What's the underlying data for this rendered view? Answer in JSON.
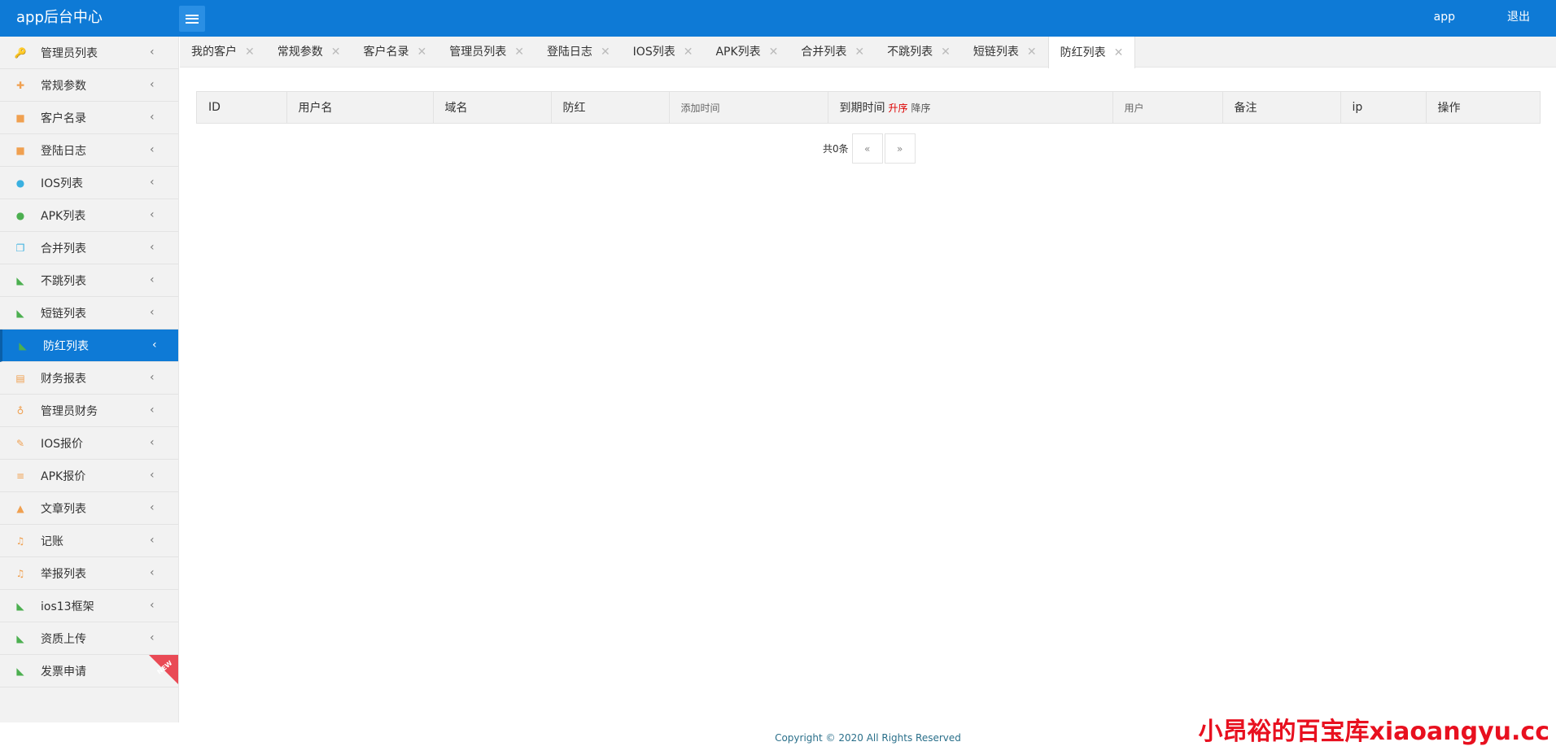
{
  "header": {
    "brand": "app后台中心",
    "user": "app",
    "logout": "退出"
  },
  "sidebar": {
    "items": [
      {
        "label": "管理员列表",
        "icon": "key-icon",
        "glyph": "🔑",
        "color": "#f0a050"
      },
      {
        "label": "常规参数",
        "icon": "plus-icon",
        "glyph": "✚",
        "color": "#f0a050"
      },
      {
        "label": "客户名录",
        "icon": "briefcase-icon",
        "glyph": "■",
        "color": "#f0a050"
      },
      {
        "label": "登陆日志",
        "icon": "briefcase-icon",
        "glyph": "■",
        "color": "#f0a050"
      },
      {
        "label": "IOS列表",
        "icon": "apple-icon",
        "glyph": "●",
        "color": "#3ab0e0"
      },
      {
        "label": "APK列表",
        "icon": "android-icon",
        "glyph": "●",
        "color": "#4caf50"
      },
      {
        "label": "合并列表",
        "icon": "copy-icon",
        "glyph": "❐",
        "color": "#3ab0e0"
      },
      {
        "label": "不跳列表",
        "icon": "rss-icon",
        "glyph": "◣",
        "color": "#4caf50"
      },
      {
        "label": "短链列表",
        "icon": "rss-icon",
        "glyph": "◣",
        "color": "#4caf50"
      },
      {
        "label": "防红列表",
        "icon": "rss-icon",
        "glyph": "◣",
        "color": "#4caf50"
      },
      {
        "label": "财务报表",
        "icon": "file-icon",
        "glyph": "▤",
        "color": "#f0a050"
      },
      {
        "label": "管理员财务",
        "icon": "stethoscope-icon",
        "glyph": "♁",
        "color": "#f0a050"
      },
      {
        "label": "IOS报价",
        "icon": "magic-wand-icon",
        "glyph": "✎",
        "color": "#f0a050"
      },
      {
        "label": "APK报价",
        "icon": "list-icon",
        "glyph": "≡",
        "color": "#f0a050"
      },
      {
        "label": "文章列表",
        "icon": "flask-icon",
        "glyph": "▲",
        "color": "#f0a050"
      },
      {
        "label": "记账",
        "icon": "music-icon",
        "glyph": "♫",
        "color": "#f0a050"
      },
      {
        "label": "举报列表",
        "icon": "music-icon",
        "glyph": "♫",
        "color": "#f0a050"
      },
      {
        "label": "ios13框架",
        "icon": "rss-icon",
        "glyph": "◣",
        "color": "#4caf50"
      },
      {
        "label": "资质上传",
        "icon": "rss-icon",
        "glyph": "◣",
        "color": "#4caf50"
      },
      {
        "label": "发票申请",
        "icon": "rss-icon",
        "glyph": "◣",
        "color": "#4caf50",
        "badge": "NEW"
      }
    ],
    "active_index": 9
  },
  "tabs": [
    {
      "label": "我的客户"
    },
    {
      "label": "常规参数"
    },
    {
      "label": "客户名录"
    },
    {
      "label": "管理员列表"
    },
    {
      "label": "登陆日志"
    },
    {
      "label": "IOS列表"
    },
    {
      "label": "APK列表"
    },
    {
      "label": "合并列表"
    },
    {
      "label": "不跳列表"
    },
    {
      "label": "短链列表"
    },
    {
      "label": "防红列表"
    }
  ],
  "active_tab": 10,
  "table": {
    "columns": [
      {
        "label": "ID"
      },
      {
        "label": "用户名"
      },
      {
        "label": "域名"
      },
      {
        "label": "防红"
      },
      {
        "label": "添加时间"
      },
      {
        "label": "到期时间"
      },
      {
        "label": "用户"
      },
      {
        "label": "备注"
      },
      {
        "label": "ip"
      },
      {
        "label": "操作"
      }
    ],
    "sort_asc": "升序",
    "sort_desc": "降序"
  },
  "pager": {
    "total": "共0条",
    "prev": "«",
    "next": "»"
  },
  "footer": "Copyright © 2020 All Rights Reserved",
  "watermark": "小昂裕的百宝库xiaoangyu.cc",
  "colors": {
    "primary": "#0e7ad6",
    "danger": "#e8101f"
  }
}
